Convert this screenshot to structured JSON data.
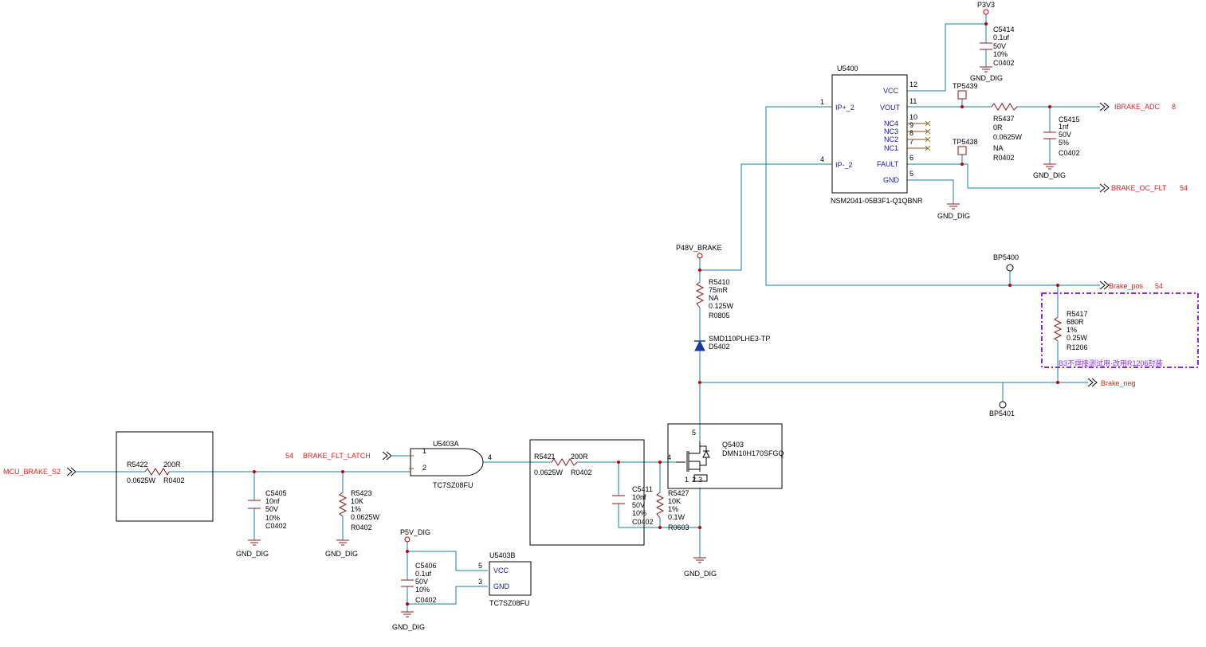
{
  "nets": {
    "mcu_brake": "MCU_BRAKE_S2",
    "brake_flt_latch": "BRAKE_FLT_LATCH",
    "brake_flt_latch_ref": "54",
    "ibrake_adc": "IBRAKE_ADC",
    "ibrake_adc_ref": "8",
    "brake_oc_flt": "BRAKE_OC_FLT",
    "brake_oc_flt_ref": "54",
    "brake_pos": "Brake_pos",
    "brake_pos_ref": "54",
    "brake_neg": "Brake_neg"
  },
  "power": {
    "p3v3": "P3V3",
    "p48v": "P48V_BRAKE",
    "p5v": "P5V_DIG",
    "gnd": "GND_DIG"
  },
  "u5400": {
    "ref": "U5400",
    "part": "NSM2041-05B3F1-Q1QBNR",
    "pins_left": [
      {
        "num": "1",
        "name": "IP+_2"
      },
      {
        "num": "4",
        "name": "IP-_2"
      }
    ],
    "pins_right": [
      {
        "num": "12",
        "name": "VCC"
      },
      {
        "num": "11",
        "name": "VOUT"
      },
      {
        "num": "10",
        "name": "NC4"
      },
      {
        "num": "9",
        "name": "NC3"
      },
      {
        "num": "8",
        "name": "NC2"
      },
      {
        "num": "7",
        "name": "NC1"
      },
      {
        "num": "6",
        "name": "FAULT"
      },
      {
        "num": "5",
        "name": "GND"
      }
    ]
  },
  "c5414": {
    "ref": "C5414",
    "val": "0.1uf",
    "volt": "50V",
    "tol": "10%",
    "pkg": "C0402"
  },
  "tp5439": "TP5439",
  "tp5438": "TP5438",
  "r5437": {
    "ref": "R5437",
    "val": "0R",
    "power": "0.0625W",
    "na": "NA",
    "pkg": "R0402"
  },
  "c5415": {
    "ref": "C5415",
    "val": "1nf",
    "volt": "50V",
    "tol": "5%",
    "pkg": "C0402"
  },
  "bp5400": "BP5400",
  "bp5401": "BP5401",
  "r5417": {
    "ref": "R5417",
    "val": "680R",
    "tol": "1%",
    "power": "0.25W",
    "pkg": "R1206"
  },
  "note": "B3不焊接测试用·改用R1206封装",
  "r5410": {
    "ref": "R5410",
    "val": "75mR",
    "na": "NA",
    "power": "0.125W",
    "pkg": "R0805"
  },
  "d5402": {
    "part": "SMD110PLHE3-TP",
    "ref": "D5402"
  },
  "q5403": {
    "ref": "Q5403",
    "part": "DMN10H170SFGQ",
    "pins": [
      "5",
      "4",
      "1",
      "2",
      "3"
    ]
  },
  "r5422": {
    "ref": "R5422",
    "val": "200R",
    "power": "0.0625W",
    "pkg": "R0402"
  },
  "c5405": {
    "ref": "C5405",
    "val": "10nf",
    "volt": "50V",
    "tol": "10%",
    "pkg": "C0402"
  },
  "r5423": {
    "ref": "R5423",
    "val": "10K",
    "tol": "1%",
    "power": "0.0625W",
    "pkg": "R0402"
  },
  "u5403a": {
    "ref": "U5403A",
    "part": "TC7SZ08FU",
    "pin1": "1",
    "pin2": "2",
    "pin4": "4"
  },
  "u5403b": {
    "ref": "U5403B",
    "part": "TC7SZ08FU",
    "pin5": "5",
    "pin3": "3",
    "vcc": "VCC",
    "gnd": "GND"
  },
  "r5421": {
    "ref": "R5421",
    "val": "200R",
    "power": "0.0625W",
    "pkg": "R0402"
  },
  "c5411": {
    "ref": "C5411",
    "val": "10nf",
    "volt": "50V",
    "tol": "10%",
    "pkg": "C0402"
  },
  "r5427": {
    "ref": "R5427",
    "val": "10K",
    "tol": "1%",
    "power": "0.1W",
    "pkg": "R0603"
  },
  "c5406": {
    "ref": "C5406",
    "val": "0.1uf",
    "volt": "50V",
    "tol": "10%",
    "pkg": "C0402"
  },
  "colors": {
    "wire": "#1a7fa8",
    "net_label": "#e31e1e",
    "pin_name": "#1a1aa0",
    "note_box": "#8a2be2",
    "junction": "#c00000"
  }
}
